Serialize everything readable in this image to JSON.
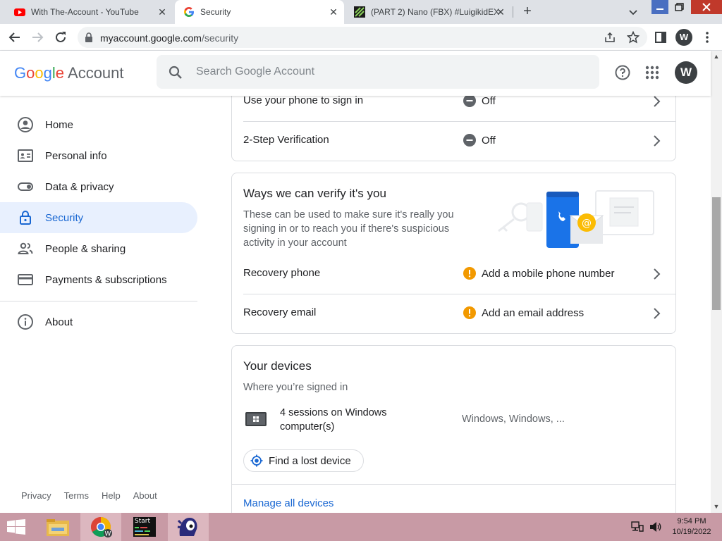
{
  "browser": {
    "tabs": [
      {
        "title": "With The-Account - YouTube",
        "favicon": "youtube-icon"
      },
      {
        "title": "Security",
        "favicon": "google-g-icon"
      },
      {
        "title": "(PART 2) Nano (FBX) #LuigikidEX",
        "favicon": "project-icon"
      }
    ],
    "url_domain": "myaccount.google.com",
    "url_path": "/security",
    "profile_initial": "W"
  },
  "header": {
    "logo_google": "Google",
    "logo_account": "Account",
    "search_placeholder": "Search Google Account",
    "avatar_initial": "W"
  },
  "sidebar": {
    "items": [
      {
        "label": "Home",
        "icon": "account-circle-icon"
      },
      {
        "label": "Personal info",
        "icon": "id-card-icon"
      },
      {
        "label": "Data & privacy",
        "icon": "toggle-icon"
      },
      {
        "label": "Security",
        "icon": "lock-icon"
      },
      {
        "label": "People & sharing",
        "icon": "people-icon"
      },
      {
        "label": "Payments & subscriptions",
        "icon": "credit-card-icon"
      },
      {
        "label": "About",
        "icon": "info-icon"
      }
    ],
    "footer": [
      "Privacy",
      "Terms",
      "Help",
      "About"
    ]
  },
  "signin": {
    "rows": [
      {
        "label": "Use your phone to sign in",
        "status": "Off"
      },
      {
        "label": "2-Step Verification",
        "status": "Off"
      }
    ]
  },
  "verify": {
    "title": "Ways we can verify it's you",
    "description": "These can be used to make sure it's really you signing in or to reach you if there's suspicious activity in your account",
    "rows": [
      {
        "label": "Recovery phone",
        "status": "Add a mobile phone number"
      },
      {
        "label": "Recovery email",
        "status": "Add an email address"
      }
    ]
  },
  "devices": {
    "title": "Your devices",
    "subtitle": "Where you’re signed in",
    "session_text": "4 sessions on Windows computer(s)",
    "session_detail": "Windows, Windows, ...",
    "find_button": "Find a lost device",
    "manage_link": "Manage all devices"
  },
  "taskbar": {
    "time": "9:54 PM",
    "date": "10/19/2022",
    "start_label": "Start"
  },
  "colors": {
    "accent_blue": "#1967d2",
    "warning_orange": "#f29900",
    "taskbar": "#c89aa5",
    "active_nav_bg": "#e8f0fe"
  }
}
